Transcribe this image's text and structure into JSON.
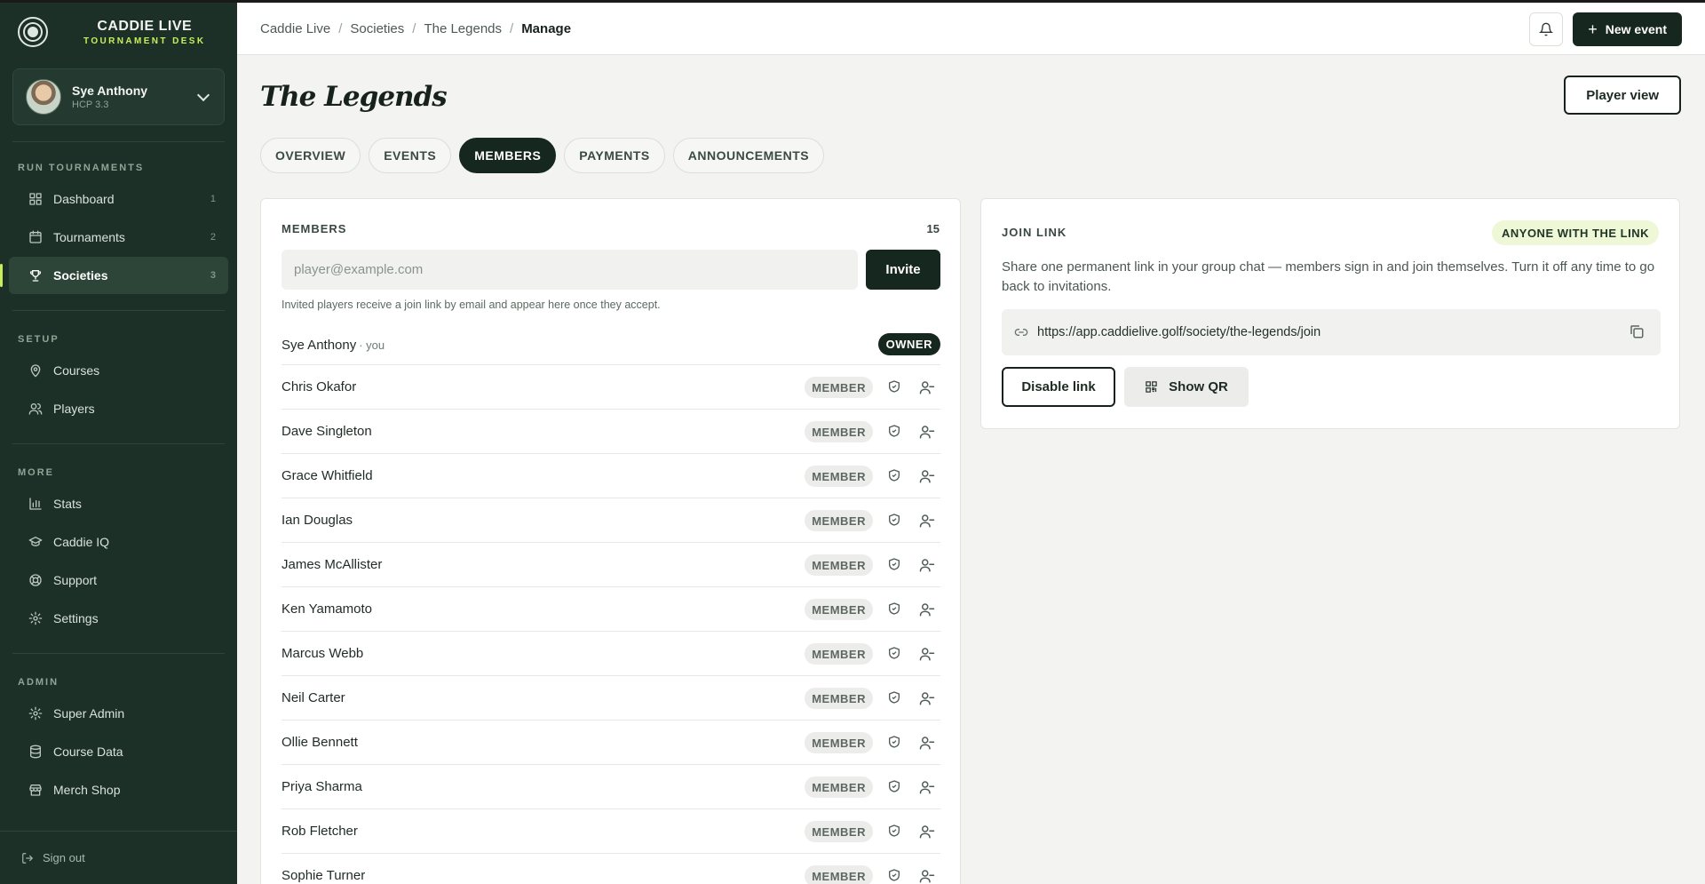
{
  "brand": {
    "name": "CADDIE LIVE",
    "subtitle": "TOURNAMENT DESK"
  },
  "user": {
    "name": "Sye Anthony",
    "handicap": "HCP 3.3"
  },
  "sidebar": {
    "sections": [
      {
        "heading": "RUN TOURNAMENTS",
        "items": [
          {
            "label": "Dashboard",
            "count": "1",
            "icon": "grid-icon"
          },
          {
            "label": "Tournaments",
            "count": "2",
            "icon": "calendar-icon"
          },
          {
            "label": "Societies",
            "count": "3",
            "icon": "trophy-icon",
            "active": true
          }
        ]
      },
      {
        "heading": "SETUP",
        "items": [
          {
            "label": "Courses",
            "icon": "map-pin-icon"
          },
          {
            "label": "Players",
            "icon": "users-icon"
          }
        ]
      },
      {
        "heading": "MORE",
        "items": [
          {
            "label": "Stats",
            "icon": "bar-chart-icon"
          },
          {
            "label": "Caddie IQ",
            "icon": "graduation-cap-icon"
          },
          {
            "label": "Support",
            "icon": "lifebuoy-icon"
          },
          {
            "label": "Settings",
            "icon": "gear-icon"
          }
        ]
      },
      {
        "heading": "ADMIN",
        "items": [
          {
            "label": "Super Admin",
            "icon": "gear-icon"
          },
          {
            "label": "Course Data",
            "icon": "database-icon"
          },
          {
            "label": "Merch Shop",
            "icon": "store-icon"
          }
        ]
      }
    ],
    "sign_out": "Sign out"
  },
  "breadcrumb": [
    "Caddie Live",
    "Societies",
    "The Legends",
    "Manage"
  ],
  "header": {
    "new_event": "New event"
  },
  "page": {
    "title": "The Legends",
    "player_view": "Player view"
  },
  "tabs": [
    {
      "label": "OVERVIEW"
    },
    {
      "label": "EVENTS"
    },
    {
      "label": "MEMBERS",
      "active": true
    },
    {
      "label": "PAYMENTS"
    },
    {
      "label": "ANNOUNCEMENTS"
    }
  ],
  "members": {
    "heading": "MEMBERS",
    "count": "15",
    "input_placeholder": "player@example.com",
    "invite_label": "Invite",
    "note": "Invited players receive a join link by email and appear here once they accept.",
    "owner": {
      "name": "Sye Anthony",
      "suffix": "· you",
      "badge": "OWNER"
    },
    "member_badge": "MEMBER",
    "list": [
      "Chris Okafor",
      "Dave Singleton",
      "Grace Whitfield",
      "Ian Douglas",
      "James McAllister",
      "Ken Yamamoto",
      "Marcus Webb",
      "Neil Carter",
      "Ollie Bennett",
      "Priya Sharma",
      "Rob Fletcher",
      "Sophie Turner"
    ]
  },
  "join_link": {
    "heading": "JOIN LINK",
    "pill": "ANYONE WITH THE LINK",
    "description": "Share one permanent link in your group chat — members sign in and join themselves. Turn it off any time to go back to invitations.",
    "url": "https://app.caddielive.golf/society/the-legends/join",
    "disable_label": "Disable link",
    "qr_label": "Show QR"
  },
  "colors": {
    "sidebar_bg": "#1d3027",
    "accent": "#c6ef5a",
    "primary": "#16271f"
  }
}
